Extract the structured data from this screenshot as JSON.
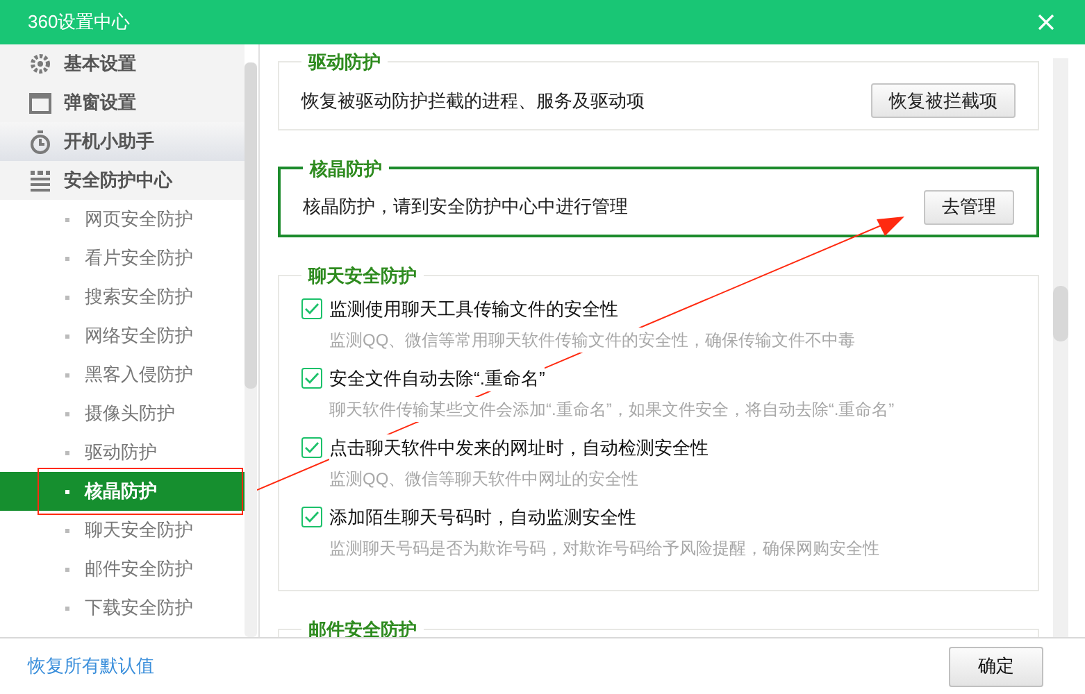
{
  "window": {
    "title": "360设置中心"
  },
  "sidebar": {
    "items": [
      {
        "label": "基本设置",
        "selected": false,
        "hovered": false
      },
      {
        "label": "弹窗设置",
        "selected": false,
        "hovered": false
      },
      {
        "label": "开机小助手",
        "selected": false,
        "hovered": true
      },
      {
        "label": "安全防护中心",
        "selected": false,
        "hovered": false,
        "children": [
          {
            "label": "网页安全防护",
            "selected": false
          },
          {
            "label": "看片安全防护",
            "selected": false
          },
          {
            "label": "搜索安全防护",
            "selected": false
          },
          {
            "label": "网络安全防护",
            "selected": false
          },
          {
            "label": "黑客入侵防护",
            "selected": false
          },
          {
            "label": "摄像头防护",
            "selected": false
          },
          {
            "label": "驱动防护",
            "selected": false
          },
          {
            "label": "核晶防护",
            "selected": true
          },
          {
            "label": "聊天安全防护",
            "selected": false
          },
          {
            "label": "邮件安全防护",
            "selected": false
          },
          {
            "label": "下载安全防护",
            "selected": false
          }
        ]
      }
    ]
  },
  "sections": [
    {
      "title": "驱动防护",
      "highlighted": false,
      "kind": "action",
      "text": "恢复被驱动防护拦截的进程、服务及驱动项",
      "button": "恢复被拦截项"
    },
    {
      "title": "核晶防护",
      "highlighted": true,
      "kind": "action",
      "text": "核晶防护，请到安全防护中心中进行管理",
      "button": "去管理"
    },
    {
      "title": "聊天安全防护",
      "highlighted": false,
      "kind": "options",
      "options": [
        {
          "label": "监测使用聊天工具传输文件的安全性",
          "hint": "监测QQ、微信等常用聊天软件传输文件的安全性，确保传输文件不中毒",
          "checked": true
        },
        {
          "label": "安全文件自动去除“.重命名”",
          "hint": "聊天软件传输某些文件会添加“.重命名”，如果文件安全，将自动去除“.重命名”",
          "checked": true
        },
        {
          "label": "点击聊天软件中发来的网址时，自动检测安全性",
          "hint": "监测QQ、微信等聊天软件中网址的安全性",
          "checked": true
        },
        {
          "label": "添加陌生聊天号码时，自动监测安全性",
          "hint": "监测聊天号码是否为欺诈号码，对欺诈号码给予风险提醒，确保网购安全性",
          "checked": true
        }
      ]
    },
    {
      "title": "邮件安全防护",
      "highlighted": false,
      "kind": "cut"
    }
  ],
  "footer": {
    "link": "恢复所有默认值",
    "button": "确定"
  }
}
